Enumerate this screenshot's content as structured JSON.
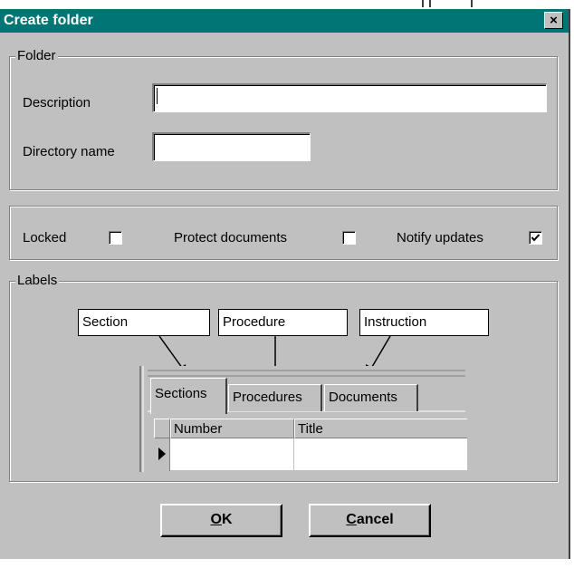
{
  "window": {
    "title": "Create folder",
    "close_glyph": "×"
  },
  "folder_group": {
    "legend": "Folder",
    "description_label": "Description",
    "description_value": "",
    "directory_label": "Directory name",
    "directory_value": ""
  },
  "options": [
    {
      "label": "Locked",
      "checked": false
    },
    {
      "label": "Protect documents",
      "checked": false
    },
    {
      "label": "Notify updates",
      "checked": true
    }
  ],
  "labels_group": {
    "legend": "Labels",
    "boxes": [
      "Section",
      "Procedure",
      "Instruction"
    ],
    "tabs": [
      "Sections",
      "Procedures",
      "Documents"
    ],
    "columns": [
      "Number",
      "Title"
    ]
  },
  "buttons": {
    "ok": {
      "accel": "O",
      "rest": "K"
    },
    "cancel": {
      "accel": "C",
      "rest": "ancel"
    }
  }
}
